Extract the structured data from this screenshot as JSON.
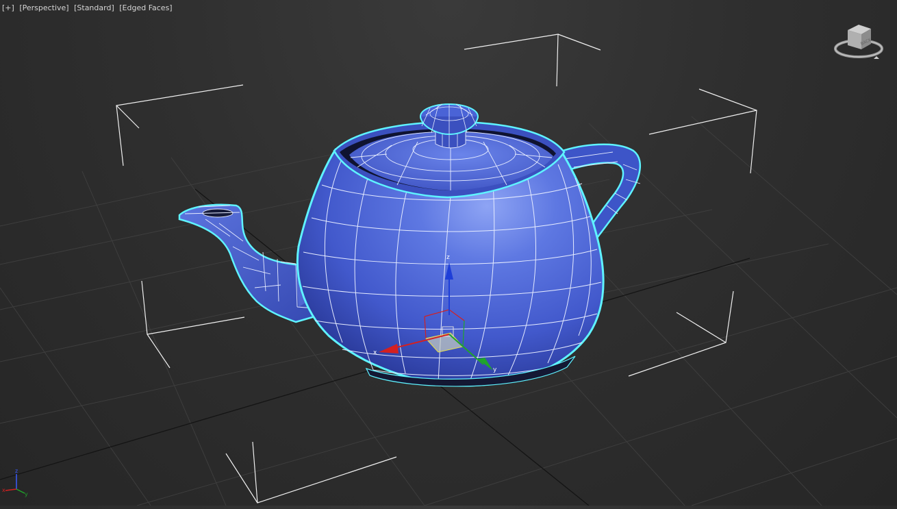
{
  "viewport": {
    "labels": {
      "plus": "[+]",
      "view": "[Perspective]",
      "shading": "[Standard]",
      "mode": "[Edged Faces]"
    },
    "viewcube_face": "BACK",
    "gizmo": {
      "x": "x",
      "y": "y",
      "z": "z"
    },
    "mini_axis": {
      "x": "x",
      "y": "y",
      "z": "z"
    }
  },
  "colors": {
    "background": "#2f2f2f",
    "grid": "#3f3f3f",
    "grid_center": "#111111",
    "teapot": "#4a63d6",
    "wire": "#ffffff",
    "selection_outline": "#5ff3ff",
    "axis_x": "#d42020",
    "axis_y": "#1fa52a",
    "axis_z": "#1f3fd8"
  },
  "icons": [
    "viewcube-icon",
    "transform-gizmo-icon",
    "world-axis-icon"
  ]
}
